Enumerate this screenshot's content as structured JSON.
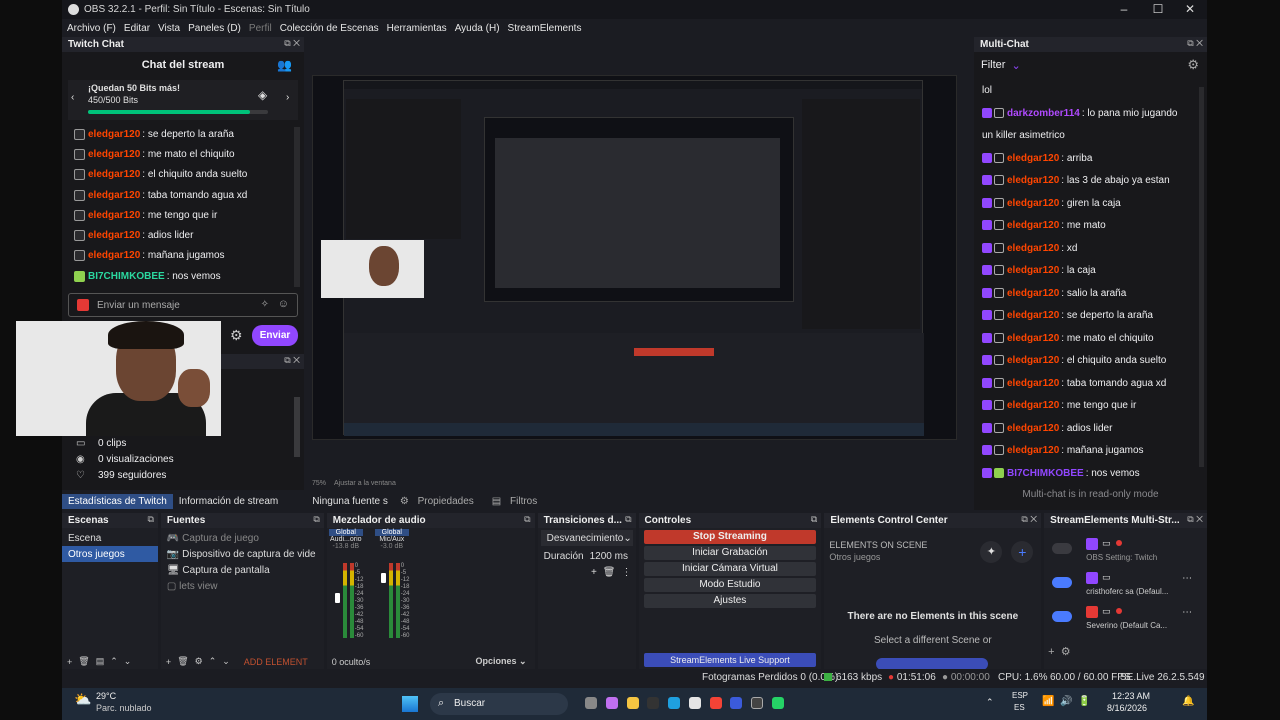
{
  "window": {
    "title": "OBS 32.2.1 - Perfil: Sin Título - Escenas: Sin Título",
    "minimize_icon": "–",
    "maximize_icon": "☐",
    "close_icon": "✕"
  },
  "menu": [
    "Archivo (F)",
    "Editar",
    "Vista",
    "Paneles (D)",
    "Perfil",
    "Colección de Escenas",
    "Herramientas",
    "Ayuda (H)",
    "StreamElements"
  ],
  "twitch_chat": {
    "dock_title": "Twitch Chat",
    "header": "Chat del stream",
    "bits_title": "¡Quedan 50 Bits más!",
    "bits_progress": "450/500 Bits",
    "bits_fraction": 0.9,
    "messages": [
      {
        "user": "eledgar120",
        "text": ": se deperto la araña",
        "badge": "mod"
      },
      {
        "user": "eledgar120",
        "text": ": me mato el chiquito",
        "badge": "mod"
      },
      {
        "user": "eledgar120",
        "text": ": el chiquito anda suelto",
        "badge": "mod"
      },
      {
        "user": "eledgar120",
        "text": ": taba tomando agua xd",
        "badge": "mod"
      },
      {
        "user": "eledgar120",
        "text": ": me tengo que ir",
        "badge": "mod"
      },
      {
        "user": "eledgar120",
        "text": ": adios lider",
        "badge": "mod"
      },
      {
        "user": "eledgar120",
        "text": ": mañana jugamos",
        "badge": "mod"
      },
      {
        "user": "BI7CHIMKOBEE",
        "text": ": nos vemos",
        "badge": "green"
      }
    ],
    "input_placeholder": "Enviar un mensaje",
    "send_label": "Enviar",
    "stats": [
      "0 clips",
      "0 visualizaciones",
      "399 seguidores"
    ]
  },
  "preview": {
    "zoom": "75%",
    "fit_label": "Ajustar a la ventana"
  },
  "multichat": {
    "dock_title": "Multi-Chat",
    "filter_label": "Filter",
    "messages": [
      {
        "user": "",
        "text": "lol",
        "badge": "none"
      },
      {
        "user": "darkzomber114",
        "text": ": lo pana mio jugando",
        "badge": "twitch"
      },
      {
        "user": "",
        "text": "un killer asimetrico",
        "badge": "none"
      },
      {
        "user": "eledgar120",
        "text": ": arriba",
        "badge": "twitch"
      },
      {
        "user": "eledgar120",
        "text": ": las 3 de abajo ya estan",
        "badge": "twitch"
      },
      {
        "user": "eledgar120",
        "text": ": giren la caja",
        "badge": "twitch"
      },
      {
        "user": "eledgar120",
        "text": ": me mato",
        "badge": "twitch"
      },
      {
        "user": "eledgar120",
        "text": ": xd",
        "badge": "twitch"
      },
      {
        "user": "eledgar120",
        "text": ": la caja",
        "badge": "twitch"
      },
      {
        "user": "eledgar120",
        "text": ": salio la araña",
        "badge": "twitch"
      },
      {
        "user": "eledgar120",
        "text": ": se deperto la araña",
        "badge": "twitch"
      },
      {
        "user": "eledgar120",
        "text": ": me mato el chiquito",
        "badge": "twitch"
      },
      {
        "user": "eledgar120",
        "text": ": el chiquito anda suelto",
        "badge": "twitch"
      },
      {
        "user": "eledgar120",
        "text": ": taba tomando agua xd",
        "badge": "twitch"
      },
      {
        "user": "eledgar120",
        "text": ": me tengo que ir",
        "badge": "twitch"
      },
      {
        "user": "eledgar120",
        "text": ": adios lider",
        "badge": "twitch"
      },
      {
        "user": "eledgar120",
        "text": ": mañana jugamos",
        "badge": "twitch"
      },
      {
        "user": "BI7CHIMKOBEE",
        "text": ": nos vemos",
        "badge": "green"
      }
    ],
    "footer": "Multi-chat is in read-only mode"
  },
  "tabs": [
    "Estadísticas de Twitch",
    "Información de stream"
  ],
  "source_bar": {
    "no_source": "Ninguna fuente s",
    "properties": "Propiedades",
    "filters": "Filtros"
  },
  "scenes": {
    "title": "Escenas",
    "items": [
      "Escena",
      "Otros juegos"
    ],
    "selected": 1
  },
  "sources": {
    "title": "Fuentes",
    "items": [
      "Captura de juego",
      "Dispositivo de captura de vide",
      "Captura de pantalla",
      "lets view"
    ],
    "add_element": "ADD ELEMENT"
  },
  "mixer": {
    "title": "Mezclador de audio",
    "channels": [
      {
        "group": "Global",
        "name": "Audi...orio",
        "db": "-13.8 dB"
      },
      {
        "group": "Global",
        "name": "Mic/Aux",
        "db": "-3.0 dB"
      }
    ],
    "scale": [
      "0",
      "-5",
      "-12",
      "-18",
      "-24",
      "-30",
      "-36",
      "-42",
      "-48",
      "-54",
      "-60"
    ],
    "hidden": "0 oculto/s",
    "options": "Opciones"
  },
  "transitions": {
    "title": "Transiciones d...",
    "type": "Desvanecimiento",
    "duration_label": "Duración",
    "duration_value": "1200 ms"
  },
  "controls": {
    "title": "Controles",
    "buttons": [
      "Stop Streaming",
      "Iniciar Grabación",
      "Iniciar Cámara Virtual",
      "Modo Estudio",
      "Ajustes"
    ],
    "support": "StreamElements Live Support"
  },
  "elements_cc": {
    "title": "Elements Control Center",
    "on_scene": "ELEMENTS ON SCENE",
    "scene_name": "Otros juegos",
    "empty": "There are no Elements in this scene",
    "hint": "Select a different Scene or"
  },
  "se_multistream": {
    "title": "StreamElements Multi-Str...",
    "entries": [
      "OBS Setting: Twitch",
      "cristhoferc sa (Defaul...",
      "Severino (Default Ca..."
    ]
  },
  "status": {
    "frames_dropped": "Fotogramas Perdidos 0 (0.0%)",
    "kbps": "6163 kbps",
    "stream_time": "01:51:06",
    "rec_time": "00:00:00",
    "cpu": "CPU: 1.6%",
    "fps": "60.00 / 60.00 FPS",
    "version": "SE.Live 26.2.5.549"
  },
  "taskbar": {
    "weather_temp": "29°C",
    "weather_desc": "Parc. nublado",
    "search": "Buscar",
    "lang": "ESP",
    "lang2": "ES",
    "time": "12:23 AM",
    "date": "8/16/2026"
  }
}
